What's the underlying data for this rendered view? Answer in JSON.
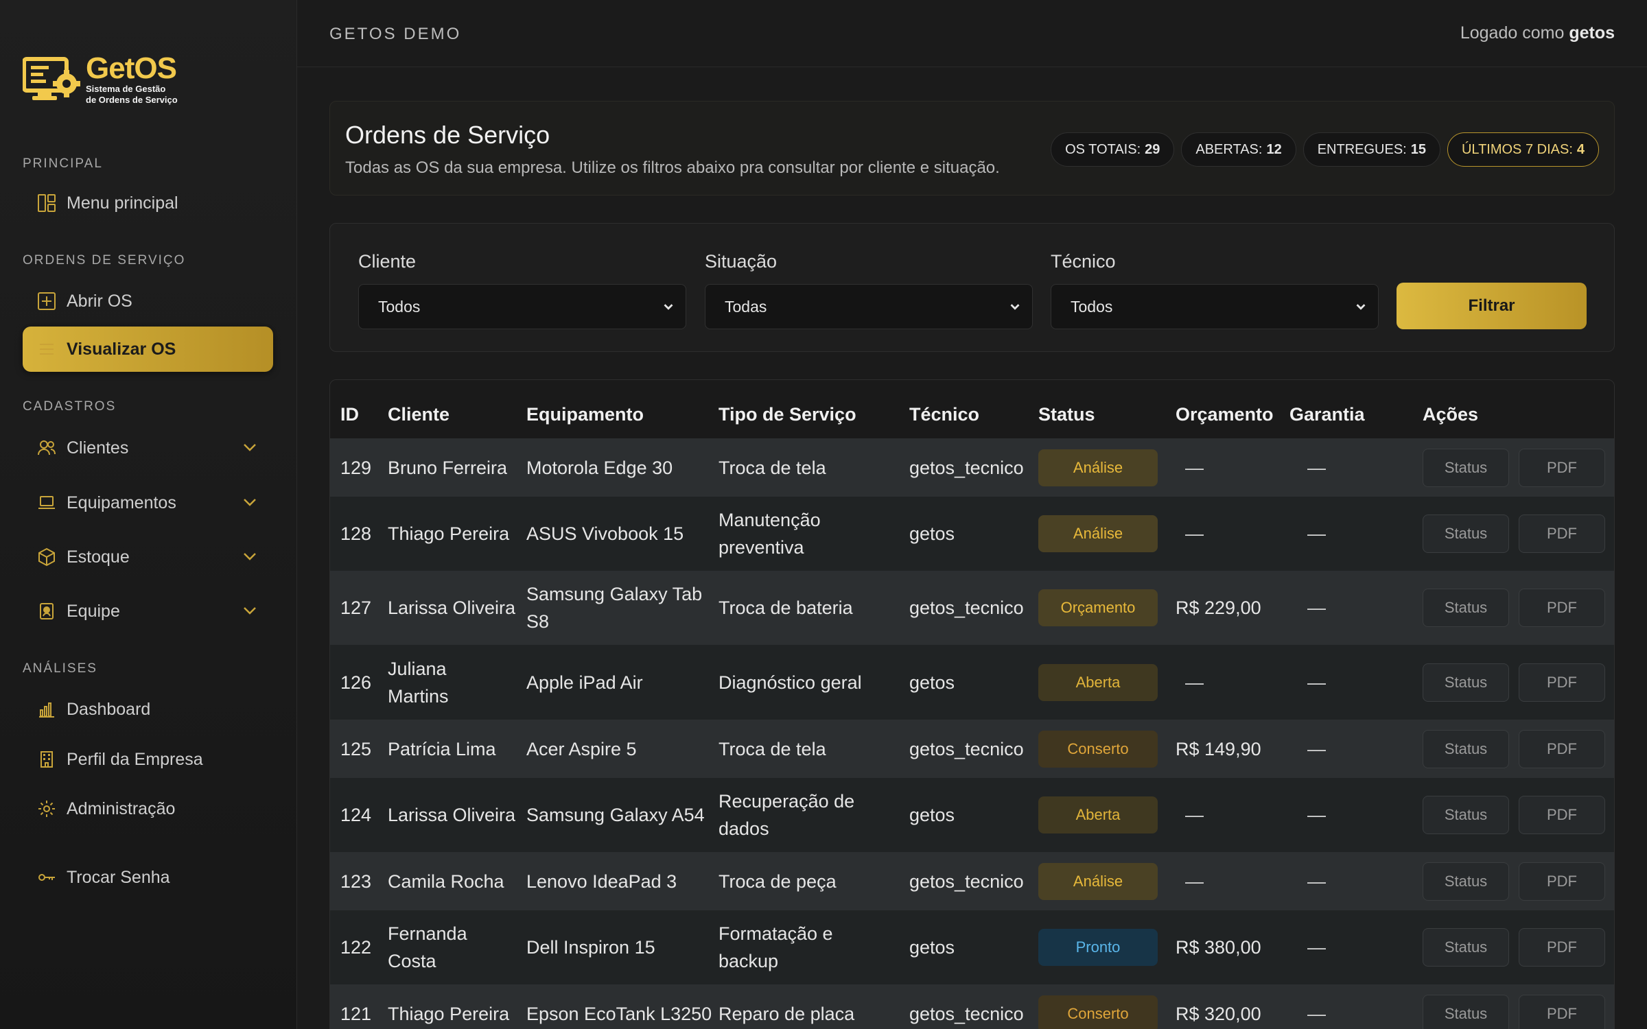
{
  "app": {
    "logo_title": "GetOS",
    "logo_sub1": "Sistema de Gestão",
    "logo_sub2": "de Ordens de Serviço",
    "topbar_title": "GETOS DEMO",
    "user_prefix": "Logado como",
    "user_name": "getos"
  },
  "sidebar": {
    "sections": [
      "PRINCIPAL",
      "ORDENS DE SERVIÇO",
      "CADASTROS",
      "ANÁLISES"
    ],
    "items": [
      {
        "label": "Menu principal",
        "icon": "layout-icon"
      },
      {
        "label": "Abrir OS",
        "icon": "plus-square-icon"
      },
      {
        "label": "Visualizar OS",
        "icon": "list-icon",
        "active": true
      },
      {
        "label": "Clientes",
        "icon": "users-icon",
        "expandable": true
      },
      {
        "label": "Equipamentos",
        "icon": "laptop-icon",
        "expandable": true
      },
      {
        "label": "Estoque",
        "icon": "box-icon",
        "expandable": true
      },
      {
        "label": "Equipe",
        "icon": "badge-icon",
        "expandable": true
      },
      {
        "label": "Dashboard",
        "icon": "bar-chart-icon"
      },
      {
        "label": "Perfil da Empresa",
        "icon": "building-icon"
      },
      {
        "label": "Administração",
        "icon": "gear-icon"
      },
      {
        "label": "Trocar Senha",
        "icon": "key-icon"
      }
    ]
  },
  "header": {
    "title": "Ordens de Serviço",
    "description": "Todas as OS da sua empresa. Utilize os filtros abaixo pra consultar por cliente e situação.",
    "stats": [
      {
        "label": "OS TOTAIS:",
        "value": "29"
      },
      {
        "label": "ABERTAS:",
        "value": "12"
      },
      {
        "label": "ENTREGUES:",
        "value": "15"
      },
      {
        "label": "ÚLTIMOS 7 DIAS:",
        "value": "4"
      }
    ]
  },
  "filters": {
    "cliente_label": "Cliente",
    "cliente_value": "Todos",
    "situacao_label": "Situação",
    "situacao_value": "Todas",
    "tecnico_label": "Técnico",
    "tecnico_value": "Todos",
    "button": "Filtrar"
  },
  "table": {
    "headers": [
      "ID",
      "Cliente",
      "Equipamento",
      "Tipo de Serviço",
      "Técnico",
      "Status",
      "Orçamento",
      "Garantia",
      "Ações"
    ],
    "action_status": "Status",
    "action_pdf": "PDF",
    "empty": "—",
    "rows": [
      {
        "id": "129",
        "cliente": [
          "Bruno Ferreira"
        ],
        "equip": [
          "Motorola Edge 30"
        ],
        "tipo": [
          "Troca de tela"
        ],
        "tecnico": "getos_tecnico",
        "status": "Análise",
        "status_kind": "analise",
        "orcamento": "—",
        "garantia": "—"
      },
      {
        "id": "128",
        "cliente": [
          "Thiago Pereira"
        ],
        "equip": [
          "ASUS Vivobook 15"
        ],
        "tipo": [
          "Manutenção",
          "preventiva"
        ],
        "tecnico": "getos",
        "status": "Análise",
        "status_kind": "analise",
        "orcamento": "—",
        "garantia": "—"
      },
      {
        "id": "127",
        "cliente": [
          "Larissa Oliveira"
        ],
        "equip": [
          "Samsung Galaxy Tab",
          "S8"
        ],
        "tipo": [
          "Troca de bateria"
        ],
        "tecnico": "getos_tecnico",
        "status": "Orçamento",
        "status_kind": "orcamento",
        "orcamento": "R$ 229,00",
        "garantia": "—"
      },
      {
        "id": "126",
        "cliente": [
          "Juliana",
          "Martins"
        ],
        "equip": [
          "Apple iPad Air"
        ],
        "tipo": [
          "Diagnóstico geral"
        ],
        "tecnico": "getos",
        "status": "Aberta",
        "status_kind": "aberta",
        "orcamento": "—",
        "garantia": "—"
      },
      {
        "id": "125",
        "cliente": [
          "Patrícia Lima"
        ],
        "equip": [
          "Acer Aspire 5"
        ],
        "tipo": [
          "Troca de tela"
        ],
        "tecnico": "getos_tecnico",
        "status": "Conserto",
        "status_kind": "conserto",
        "orcamento": "R$ 149,90",
        "garantia": "—"
      },
      {
        "id": "124",
        "cliente": [
          "Larissa Oliveira"
        ],
        "equip": [
          "Samsung Galaxy A54"
        ],
        "tipo": [
          "Recuperação de",
          "dados"
        ],
        "tecnico": "getos",
        "status": "Aberta",
        "status_kind": "aberta",
        "orcamento": "—",
        "garantia": "—"
      },
      {
        "id": "123",
        "cliente": [
          "Camila Rocha"
        ],
        "equip": [
          "Lenovo IdeaPad 3"
        ],
        "tipo": [
          "Troca de peça"
        ],
        "tecnico": "getos_tecnico",
        "status": "Análise",
        "status_kind": "analise",
        "orcamento": "—",
        "garantia": "—"
      },
      {
        "id": "122",
        "cliente": [
          "Fernanda",
          "Costa"
        ],
        "equip": [
          "Dell Inspiron 15"
        ],
        "tipo": [
          "Formatação e",
          "backup"
        ],
        "tecnico": "getos",
        "status": "Pronto",
        "status_kind": "pronto",
        "orcamento": "R$ 380,00",
        "garantia": "—"
      },
      {
        "id": "121",
        "cliente": [
          "Thiago Pereira"
        ],
        "equip": [
          "Epson EcoTank L3250"
        ],
        "tipo": [
          "Reparo de placa"
        ],
        "tecnico": "getos_tecnico",
        "status": "Conserto",
        "status_kind": "conserto",
        "orcamento": "R$ 320,00",
        "garantia": "—"
      }
    ]
  },
  "colors": {
    "accent": "#d6b23b",
    "badge_analise_bg": "#4a4124",
    "badge_analise_fg": "#e8b93a",
    "badge_orcamento_bg": "#4a4124",
    "badge_orcamento_fg": "#e8b93a",
    "badge_aberta_bg": "#3f3820",
    "badge_aberta_fg": "#e1b43a",
    "badge_conserto_bg": "#40361f",
    "badge_conserto_fg": "#e0a63a",
    "badge_pronto_bg": "#173447",
    "badge_pronto_fg": "#5ab6ea"
  }
}
